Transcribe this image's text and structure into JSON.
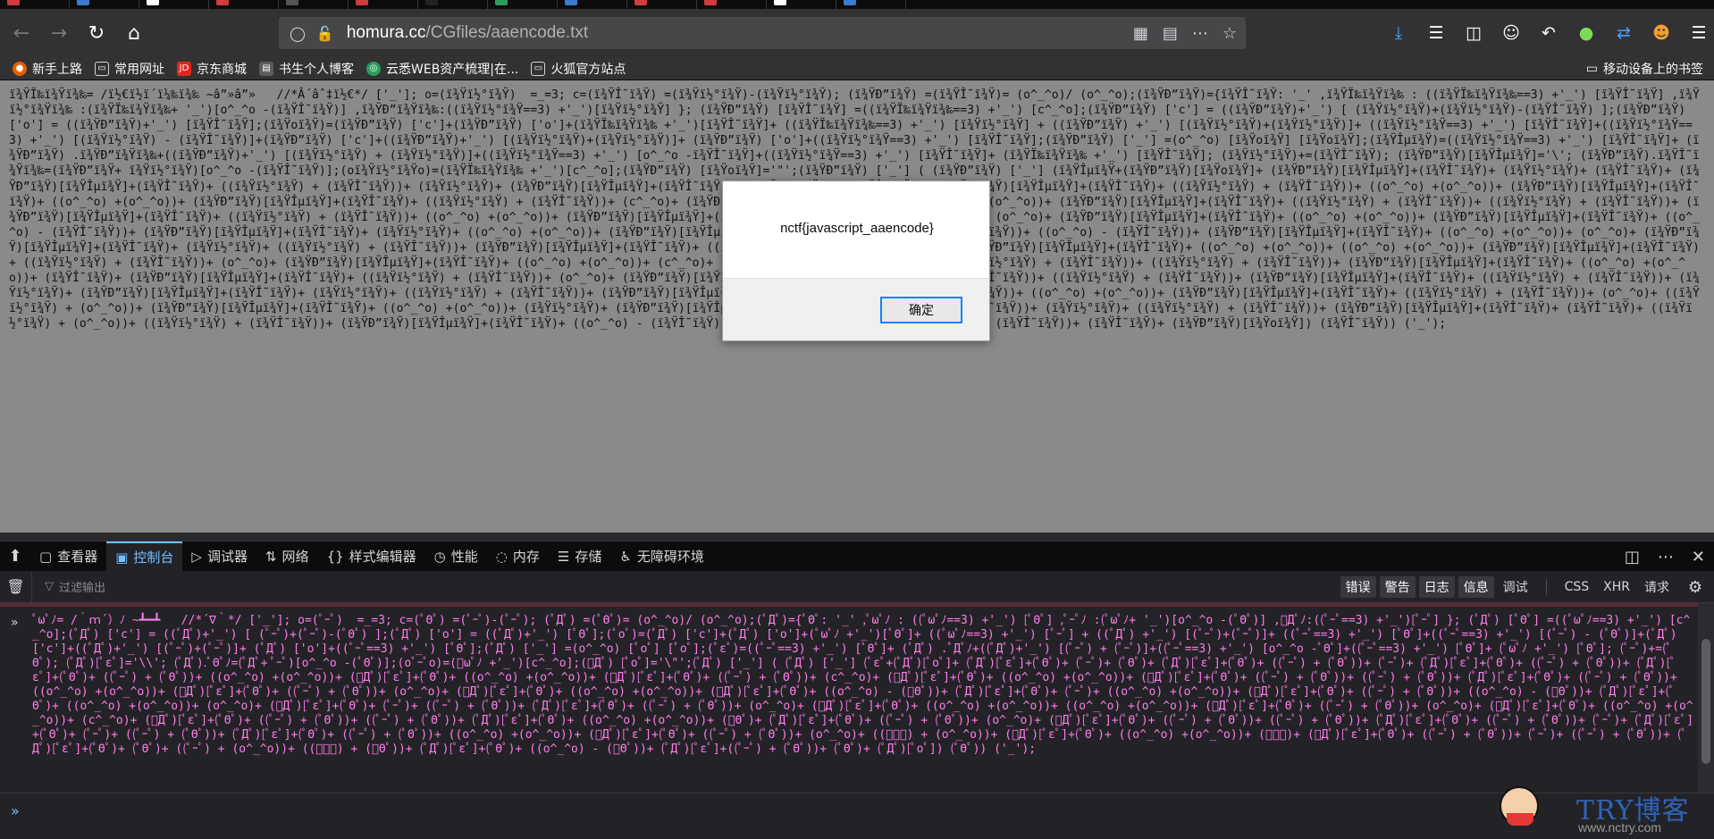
{
  "browser": {
    "url_domain": "homura.cc",
    "url_path": "/CGfiles/aaencode.txt",
    "bookmarks": [
      {
        "label": "新手上路",
        "color": "#e66000",
        "glyph": "●"
      },
      {
        "label": "常用网址",
        "color": "#6b6b6b",
        "glyph": "▭"
      },
      {
        "label": "京东商城",
        "color": "#e1251b",
        "glyph": "JD"
      },
      {
        "label": "书生个人博客",
        "color": "#5b5b5b",
        "glyph": "▤"
      },
      {
        "label": "云悉WEB资产梳理|在...",
        "color": "#2e9d5b",
        "glyph": "◎"
      },
      {
        "label": "火狐官方站点",
        "color": "#6b6b6b",
        "glyph": "▭"
      }
    ],
    "mobile_bookmarks": "移动设备上的书签"
  },
  "page": {
    "content": "ï¾ŸÏ‰ï¾Ÿï¾‰= /ï½€ï½ï´ï¼‰ï¾‰ ~â”»â”»   //*Â´âˆ‡ï½€*/ ['_']; o=(ï¾Ÿï½°ï¾Ÿ)  =_=3; c=(ï¾ŸÎ˜ï¾Ÿ) =(ï¾Ÿï½°ï¾Ÿ)-(ï¾Ÿï½°ï¾Ÿ); (ï¾ŸÐ”ï¾Ÿ) =(ï¾ŸÎ˜ï¾Ÿ)= (o^_^o)/ (o^_^o);(ï¾ŸÐ”ï¾Ÿ)={ï¾ŸÎ˜ï¾Ÿ: '_' ,ï¾ŸÏ‰ï¾Ÿï¾‰ : ((ï¾ŸÏ‰ï¾Ÿï¾‰==3) +'_') [ï¾ŸÎ˜ï¾Ÿ] ,ï¾Ÿï½°ï¾Ÿï¾‰ :(ï¾ŸÏ‰ï¾Ÿï¾‰+ '_')[o^_^o -(ï¾ŸÎ˜ï¾Ÿ)] ,ï¾ŸÐ”ï¾Ÿï¾‰:((ï¾Ÿï½°ï¾Ÿ==3) +'_')[ï¾Ÿï½°ï¾Ÿ] }; (ï¾ŸÐ”ï¾Ÿ) [ï¾ŸÎ˜ï¾Ÿ] =((ï¾ŸÏ‰ï¾Ÿï¾‰==3) +'_') [c^_^o];(ï¾ŸÐ”ï¾Ÿ) ['c'] = ((ï¾ŸÐ”ï¾Ÿ)+'_') [ (ï¾Ÿï½°ï¾Ÿ)+(ï¾Ÿï½°ï¾Ÿ)-(ï¾ŸÎ˜ï¾Ÿ) ];(ï¾ŸÐ”ï¾Ÿ) ['o'] = ((ï¾ŸÐ”ï¾Ÿ)+'_') [ï¾ŸÎ˜ï¾Ÿ];(ï¾Ÿoï¾Ÿ)=(ï¾ŸÐ”ï¾Ÿ) ['c']+(ï¾ŸÐ”ï¾Ÿ) ['o']+(ï¾ŸÏ‰ï¾Ÿï¾‰ +'_')[ï¾ŸÎ˜ï¾Ÿ]+ ((ï¾ŸÏ‰ï¾Ÿï¾‰==3) +'_') [ï¾Ÿï½°ï¾Ÿ] + ((ï¾ŸÐ”ï¾Ÿ) +'_') [(ï¾Ÿï½°ï¾Ÿ)+(ï¾Ÿï½°ï¾Ÿ)]+ ((ï¾Ÿï½°ï¾Ÿ==3) +'_') [ï¾ŸÎ˜ï¾Ÿ]+((ï¾Ÿï½°ï¾Ÿ==3) +'_') [(ï¾Ÿï½°ï¾Ÿ) - (ï¾ŸÎ˜ï¾Ÿ)]+(ï¾ŸÐ”ï¾Ÿ) ['c']+((ï¾ŸÐ”ï¾Ÿ)+'_') [(ï¾Ÿï½°ï¾Ÿ)+(ï¾Ÿï½°ï¾Ÿ)]+ (ï¾ŸÐ”ï¾Ÿ) ['o']+((ï¾Ÿï½°ï¾Ÿ==3) +'_') [ï¾ŸÎ˜ï¾Ÿ];(ï¾ŸÐ”ï¾Ÿ) ['_'] =(o^_^o) [ï¾Ÿoï¾Ÿ] [ï¾Ÿoï¾Ÿ];(ï¾ŸÎµï¾Ÿ)=((ï¾Ÿï½°ï¾Ÿ==3) +'_') [ï¾ŸÎ˜ï¾Ÿ]+ (ï¾ŸÐ”ï¾Ÿ) .ï¾ŸÐ”ï¾Ÿï¾‰+((ï¾ŸÐ”ï¾Ÿ)+'_') [(ï¾Ÿï½°ï¾Ÿ) + (ï¾Ÿï½°ï¾Ÿ)]+((ï¾Ÿï½°ï¾Ÿ==3) +'_') [o^_^o -ï¾ŸÎ˜ï¾Ÿ]+((ï¾Ÿï½°ï¾Ÿ==3) +'_') [ï¾ŸÎ˜ï¾Ÿ]+ (ï¾ŸÏ‰ï¾Ÿï¾‰ +'_') [ï¾ŸÎ˜ï¾Ÿ]; (ï¾Ÿï½°ï¾Ÿ)+=(ï¾ŸÎ˜ï¾Ÿ); (ï¾ŸÐ”ï¾Ÿ)[ï¾ŸÎµï¾Ÿ]='\\'; (ï¾ŸÐ”ï¾Ÿ).ï¾ŸÎ˜ï¾Ÿï¾‰=(ï¾ŸÐ”ï¾Ÿ+ ï¾Ÿï½°ï¾Ÿ)[o^_^o -(ï¾ŸÎ˜ï¾Ÿ)];(oï¾Ÿï½°ï¾Ÿo)=(ï¾ŸÏ‰ï¾Ÿï¾‰ +'_')[c^_^o];(ï¾ŸÐ”ï¾Ÿ) [ï¾Ÿoï¾Ÿ]='\"';(ï¾ŸÐ”ï¾Ÿ) ['_'] ( (ï¾ŸÐ”ï¾Ÿ) ['_'] (ï¾ŸÎµï¾Ÿ+(ï¾ŸÐ”ï¾Ÿ)[ï¾Ÿoï¾Ÿ]+ (ï¾ŸÐ”ï¾Ÿ)[ï¾ŸÎµï¾Ÿ]+(ï¾ŸÎ˜ï¾Ÿ)+ (ï¾Ÿï½°ï¾Ÿ)+ (ï¾ŸÎ˜ï¾Ÿ)+ (ï¾ŸÐ”ï¾Ÿ)[ï¾ŸÎµï¾Ÿ]+(ï¾ŸÎ˜ï¾Ÿ)+ ((ï¾Ÿï½°ï¾Ÿ) + (ï¾ŸÎ˜ï¾Ÿ))+ (ï¾Ÿï½°ï¾Ÿ)+ (ï¾ŸÐ”ï¾Ÿ)[ï¾ŸÎµï¾Ÿ]+(ï¾ŸÎ˜ï¾Ÿ)+ ((ï¾Ÿï½°ï¾Ÿ) + (ï¾ŸÎ˜ï¾Ÿ))+ (ï¾ŸÐ”ï¾Ÿ)[ï¾ŸÎµï¾Ÿ]+(ï¾ŸÎ˜ï¾Ÿ)+ ((ï¾Ÿï½°ï¾Ÿ) + (ï¾ŸÎ˜ï¾Ÿ))+ ((o^_^o) +(o^_^o))+ (ï¾ŸÐ”ï¾Ÿ)[ï¾ŸÎµï¾Ÿ]+(ï¾ŸÎ˜ï¾Ÿ)+ ((o^_^o) +(o^_^o))+ (ï¾ŸÐ”ï¾Ÿ)[ï¾ŸÎµï¾Ÿ]+(ï¾ŸÎ˜ï¾Ÿ)+ ((ï¾Ÿï½°ï¾Ÿ) + (ï¾ŸÎ˜ï¾Ÿ))+ (c^_^o)+ (ï¾ŸÐ”ï¾Ÿ)[ï¾ŸÎµï¾Ÿ]+(ï¾ŸÎ˜ï¾Ÿ)+ ((o^_^o) +(o^_^o))+ (ï¾ŸÐ”ï¾Ÿ)[ï¾ŸÎµï¾Ÿ]+(ï¾ŸÎ˜ï¾Ÿ)+ ((ï¾Ÿï½°ï¾Ÿ) + (ï¾ŸÎ˜ï¾Ÿ))+ ((ï¾Ÿï½°ï¾Ÿ) + (ï¾ŸÎ˜ï¾Ÿ))+ (ï¾ŸÐ”ï¾Ÿ)[ï¾ŸÎµï¾Ÿ]+(ï¾ŸÎ˜ï¾Ÿ)+ ((ï¾Ÿï½°ï¾Ÿ) + (ï¾ŸÎ˜ï¾Ÿ))+ ((o^_^o) +(o^_^o))+ (ï¾ŸÐ”ï¾Ÿ)[ï¾ŸÎµï¾Ÿ]+(ï¾ŸÎ˜ï¾Ÿ)+ ((ï¾Ÿï½°ï¾Ÿ) + (ï¾ŸÎ˜ï¾Ÿ))+ (o^_^o)+ (ï¾ŸÐ”ï¾Ÿ)[ï¾ŸÎµï¾Ÿ]+(ï¾ŸÎ˜ï¾Ÿ)+ ((o^_^o) +(o^_^o))+ (ï¾ŸÐ”ï¾Ÿ)[ï¾ŸÎµï¾Ÿ]+(ï¾ŸÎ˜ï¾Ÿ)+ ((o^_^o) - (ï¾ŸÎ˜ï¾Ÿ))+ (ï¾ŸÐ”ï¾Ÿ)[ï¾ŸÎµï¾Ÿ]+(ï¾ŸÎ˜ï¾Ÿ)+ (ï¾Ÿï½°ï¾Ÿ)+ ((o^_^o) +(o^_^o))+ (ï¾ŸÐ”ï¾Ÿ)[ï¾ŸÎµï¾Ÿ]+(ï¾ŸÎ˜ï¾Ÿ)+ ((ï¾Ÿï½°ï¾Ÿ) + (ï¾ŸÎ˜ï¾Ÿ))+ ((o^_^o) - (ï¾ŸÎ˜ï¾Ÿ))+ (ï¾ŸÐ”ï¾Ÿ)[ï¾ŸÎµï¾Ÿ]+(ï¾ŸÎ˜ï¾Ÿ)+ ((o^_^o) +(o^_^o))+ (o^_^o)+ (ï¾ŸÐ”ï¾Ÿ)[ï¾ŸÎµï¾Ÿ]+(ï¾ŸÎ˜ï¾Ÿ)+ (ï¾Ÿï½°ï¾Ÿ)+ ((ï¾Ÿï½°ï¾Ÿ) + (ï¾ŸÎ˜ï¾Ÿ))+ (ï¾ŸÐ”ï¾Ÿ)[ï¾ŸÎµï¾Ÿ]+(ï¾ŸÎ˜ï¾Ÿ)+ ((ï¾Ÿï½°ï¾Ÿ) + (ï¾ŸÎ˜ï¾Ÿ))+ (o^_^o)+ (ï¾ŸÐ”ï¾Ÿ)[ï¾ŸÎµï¾Ÿ]+(ï¾ŸÎ˜ï¾Ÿ)+ ((o^_^o) +(o^_^o))+ ((o^_^o) +(o^_^o))+ (ï¾ŸÐ”ï¾Ÿ)[ï¾ŸÎµï¾Ÿ]+(ï¾ŸÎ˜ï¾Ÿ)+ ((ï¾Ÿï½°ï¾Ÿ) + (ï¾ŸÎ˜ï¾Ÿ))+ (o^_^o)+ (ï¾ŸÐ”ï¾Ÿ)[ï¾ŸÎµï¾Ÿ]+(ï¾ŸÎ˜ï¾Ÿ)+ ((o^_^o) +(o^_^o))+ (c^_^o)+ (ï¾ŸÐ”ï¾Ÿ)[ï¾ŸÎµï¾Ÿ]+(ï¾ŸÎ˜ï¾Ÿ)+ ((ï¾Ÿï½°ï¾Ÿ) + (ï¾ŸÎ˜ï¾Ÿ))+ ((ï¾Ÿï½°ï¾Ÿ) + (ï¾ŸÎ˜ï¾Ÿ))+ (ï¾ŸÐ”ï¾Ÿ)[ï¾ŸÎµï¾Ÿ]+(ï¾ŸÎ˜ï¾Ÿ)+ ((o^_^o) +(o^_^o))+ (ï¾ŸÎ˜ï¾Ÿ)+ (ï¾ŸÐ”ï¾Ÿ)[ï¾ŸÎµï¾Ÿ]+(ï¾ŸÎ˜ï¾Ÿ)+ ((ï¾Ÿï½°ï¾Ÿ) + (ï¾ŸÎ˜ï¾Ÿ))+ (o^_^o)+ (ï¾ŸÐ”ï¾Ÿ)[ï¾ŸÎµï¾Ÿ]+(ï¾ŸÎ˜ï¾Ÿ)+ ((ï¾Ÿï½°ï¾Ÿ) + (ï¾ŸÎ˜ï¾Ÿ))+ ((ï¾Ÿï½°ï¾Ÿ) + (ï¾ŸÎ˜ï¾Ÿ))+ (ï¾ŸÐ”ï¾Ÿ)[ï¾ŸÎµï¾Ÿ]+(ï¾ŸÎ˜ï¾Ÿ)+ ((ï¾Ÿï½°ï¾Ÿ) + (ï¾ŸÎ˜ï¾Ÿ))+ (ï¾Ÿï½°ï¾Ÿ)+ (ï¾ŸÐ”ï¾Ÿ)[ï¾ŸÎµï¾Ÿ]+(ï¾ŸÎ˜ï¾Ÿ)+ (ï¾Ÿï½°ï¾Ÿ)+ ((ï¾Ÿï½°ï¾Ÿ) + (ï¾ŸÎ˜ï¾Ÿ))+ (ï¾ŸÐ”ï¾Ÿ)[ï¾ŸÎµï¾Ÿ]+(ï¾ŸÎ˜ï¾Ÿ)+ ((ï¾Ÿï½°ï¾Ÿ) + (ï¾ŸÎ˜ï¾Ÿ))+ ((o^_^o) +(o^_^o))+ (ï¾ŸÐ”ï¾Ÿ)[ï¾ŸÎµï¾Ÿ]+(ï¾ŸÎ˜ï¾Ÿ)+ ((ï¾Ÿï½°ï¾Ÿ) + (ï¾ŸÎ˜ï¾Ÿ))+ (o^_^o)+ ((ï¾Ÿï½°ï¾Ÿ) + (o^_^o))+ (ï¾ŸÐ”ï¾Ÿ)[ï¾ŸÎµï¾Ÿ]+(ï¾ŸÎ˜ï¾Ÿ)+ ((o^_^o) +(o^_^o))+ (ï¾Ÿï½°ï¾Ÿ)+ (ï¾ŸÐ”ï¾Ÿ)[ï¾ŸÎµï¾Ÿ]+(ï¾ŸÎ˜ï¾Ÿ)+ ((ï¾Ÿï½°ï¾Ÿ) + (ï¾ŸÎ˜ï¾Ÿ))+ (ï¾Ÿï½°ï¾Ÿ)+ ((ï¾Ÿï½°ï¾Ÿ) + (ï¾ŸÎ˜ï¾Ÿ))+ (ï¾ŸÐ”ï¾Ÿ)[ï¾ŸÎµï¾Ÿ]+(ï¾ŸÎ˜ï¾Ÿ)+ (ï¾ŸÎ˜ï¾Ÿ)+ ((ï¾Ÿï½°ï¾Ÿ) + (o^_^o))+ ((ï¾Ÿï½°ï¾Ÿ) + (ï¾ŸÎ˜ï¾Ÿ))+ (ï¾ŸÐ”ï¾Ÿ)[ï¾ŸÎµï¾Ÿ]+(ï¾ŸÎ˜ï¾Ÿ)+ ((o^_^o) - (ï¾ŸÎ˜ï¾Ÿ))+ (ï¾ŸÐ”ï¾Ÿ)[ï¾ŸÎµï¾Ÿ]+((ï¾Ÿï½°ï¾Ÿ) + (ï¾ŸÎ˜ï¾Ÿ))+ (ï¾ŸÎ˜ï¾Ÿ)+ (ï¾ŸÐ”ï¾Ÿ)[ï¾Ÿoï¾Ÿ]) (ï¾ŸÎ˜ï¾Ÿ)) ('_');"
  },
  "dialog": {
    "message": "nctf{javascript_aaencode}",
    "ok_label": "确定"
  },
  "devtools": {
    "tabs": [
      {
        "label": "查看器",
        "icon": "▢"
      },
      {
        "label": "控制台",
        "icon": "▣",
        "selected": true
      },
      {
        "label": "调试器",
        "icon": "▷"
      },
      {
        "label": "网络",
        "icon": "⇅"
      },
      {
        "label": "样式编辑器",
        "icon": "{}"
      },
      {
        "label": "性能",
        "icon": "◷"
      },
      {
        "label": "内存",
        "icon": "◌"
      },
      {
        "label": "存储",
        "icon": "☰"
      },
      {
        "label": "无障碍环境",
        "icon": "♿"
      }
    ],
    "filter_placeholder": "过滤输出",
    "levels": [
      {
        "label": "错误",
        "on": true
      },
      {
        "label": "警告",
        "on": true
      },
      {
        "label": "日志",
        "on": true
      },
      {
        "label": "信息",
        "on": true
      },
      {
        "label": "调试",
        "on": false
      }
    ],
    "extra_filters": [
      "CSS",
      "XHR",
      "请求"
    ],
    "console_output": "ﾟωﾟﾉ= /｀ｍ´）ﾉ ~┻━┻   //*´∇｀*/ ['_']; o=(ﾟｰﾟ)  =_=3; c=(ﾟΘﾟ) =(ﾟｰﾟ)-(ﾟｰﾟ); (ﾟДﾟ) =(ﾟΘﾟ)= (o^_^o)/ (o^_^o);(ﾟДﾟ)={ﾟΘﾟ: '_' ,ﾟωﾟﾉ : ((ﾟωﾟﾉ==3) +'_') [ﾟΘﾟ] ,ﾟｰﾟﾉ :(ﾟωﾟﾉ+ '_')[o^_^o -(ﾟΘﾟ)] ,ﾟДﾟﾉ:((ﾟｰﾟ==3) +'_')[ﾟｰﾟ] }; (ﾟДﾟ) [ﾟΘﾟ] =((ﾟωﾟﾉ==3) +'_') [c^_^o];(ﾟДﾟ) ['c'] = ((ﾟДﾟ)+'_') [ (ﾟｰﾟ)+(ﾟｰﾟ)-(ﾟΘﾟ) ];(ﾟДﾟ) ['o'] = ((ﾟДﾟ)+'_') [ﾟΘﾟ];(ﾟoﾟ)=(ﾟДﾟ) ['c']+(ﾟДﾟ) ['o']+(ﾟωﾟﾉ +'_')[ﾟΘﾟ]+ ((ﾟωﾟﾉ==3) +'_') [ﾟｰﾟ] + ((ﾟДﾟ) +'_') [(ﾟｰﾟ)+(ﾟｰﾟ)]+ ((ﾟｰﾟ==3) +'_') [ﾟΘﾟ]+((ﾟｰﾟ==3) +'_') [(ﾟｰﾟ) - (ﾟΘﾟ)]+(ﾟДﾟ) ['c']+((ﾟДﾟ)+'_') [(ﾟｰﾟ)+(ﾟｰﾟ)]+ (ﾟДﾟ) ['o']+((ﾟｰﾟ==3) +'_') [ﾟΘﾟ];(ﾟДﾟ) ['_'] =(o^_^o) [ﾟoﾟ] [ﾟoﾟ];(ﾟεﾟ)=((ﾟｰﾟ==3) +'_') [ﾟΘﾟ]+ (ﾟДﾟ) .ﾟДﾟﾉ+((ﾟДﾟ)+'_') [(ﾟｰﾟ) + (ﾟｰﾟ)]+((ﾟｰﾟ==3) +'_') [o^_^o -ﾟΘﾟ]+((ﾟｰﾟ==3) +'_') [ﾟΘﾟ]+ (ﾟωﾟﾉ +'_') [ﾟΘﾟ]; (ﾟｰﾟ)+=(ﾟΘﾟ); (ﾟДﾟ)[ﾟεﾟ]='\\\\'; (ﾟДﾟ).ﾟΘﾟﾉ=(ﾟДﾟ+ ﾟｰﾟ)[o^_^o -(ﾟΘﾟ)];(oﾟｰﾟo)=(ﾟωﾟﾉ +'_')[c^_^o];(ﾟДﾟ) [ﾟoﾟ]='\\\"';(ﾟДﾟ) ['_'] ( (ﾟДﾟ) ['_'] (ﾟεﾟ+(ﾟДﾟ)[ﾟoﾟ]+ (ﾟДﾟ)[ﾟεﾟ]+(ﾟΘﾟ)+ (ﾟｰﾟ)+ (ﾟΘﾟ)+ (ﾟДﾟ)[ﾟεﾟ]+(ﾟΘﾟ)+ ((ﾟｰﾟ) + (ﾟΘﾟ))+ (ﾟｰﾟ)+ (ﾟДﾟ)[ﾟεﾟ]+(ﾟΘﾟ)+ ((ﾟｰﾟ) + (ﾟΘﾟ))+ (ﾟДﾟ)[ﾟεﾟ]+(ﾟΘﾟ)+ ((ﾟｰﾟ) + (ﾟΘﾟ))+ ((o^_^o) +(o^_^o))+ (ﾟДﾟ)[ﾟεﾟ]+(ﾟΘﾟ)+ ((o^_^o) +(o^_^o))+ (ﾟДﾟ)[ﾟεﾟ]+(ﾟΘﾟ)+ ((ﾟｰﾟ) + (ﾟΘﾟ))+ (c^_^o)+ (ﾟДﾟ)[ﾟεﾟ]+(ﾟΘﾟ)+ ((o^_^o) +(o^_^o))+ (ﾟДﾟ)[ﾟεﾟ]+(ﾟΘﾟ)+ ((ﾟｰﾟ) + (ﾟΘﾟ))+ ((ﾟｰﾟ) + (ﾟΘﾟ))+ (ﾟДﾟ)[ﾟεﾟ]+(ﾟΘﾟ)+ ((ﾟｰﾟ) + (ﾟΘﾟ))+ ((o^_^o) +(o^_^o))+ (ﾟДﾟ)[ﾟεﾟ]+(ﾟΘﾟ)+ ((ﾟｰﾟ) + (ﾟΘﾟ))+ (o^_^o)+ (ﾟДﾟ)[ﾟεﾟ]+(ﾟΘﾟ)+ ((o^_^o) +(o^_^o))+ (ﾟДﾟ)[ﾟεﾟ]+(ﾟΘﾟ)+ ((o^_^o) - (ﾟΘﾟ))+ (ﾟДﾟ)[ﾟεﾟ]+(ﾟΘﾟ)+ (ﾟｰﾟ)+ ((o^_^o) +(o^_^o))+ (ﾟДﾟ)[ﾟεﾟ]+(ﾟΘﾟ)+ ((ﾟｰﾟ) + (ﾟΘﾟ))+ ((o^_^o) - (ﾟΘﾟ))+ (ﾟДﾟ)[ﾟεﾟ]+(ﾟΘﾟ)+ ((o^_^o) +(o^_^o))+ (o^_^o)+ (ﾟДﾟ)[ﾟεﾟ]+(ﾟΘﾟ)+ (ﾟｰﾟ)+ ((ﾟｰﾟ) + (ﾟΘﾟ))+ (ﾟДﾟ)[ﾟεﾟ]+(ﾟΘﾟ)+ ((ﾟｰﾟ) + (ﾟΘﾟ))+ (o^_^o)+ (ﾟДﾟ)[ﾟεﾟ]+(ﾟΘﾟ)+ ((o^_^o) +(o^_^o))+ ((o^_^o) +(o^_^o))+ (ﾟДﾟ)[ﾟεﾟ]+(ﾟΘﾟ)+ ((ﾟｰﾟ) + (ﾟΘﾟ))+ (o^_^o)+ (ﾟДﾟ)[ﾟεﾟ]+(ﾟΘﾟ)+ ((o^_^o) +(o^_^o))+ (c^_^o)+ (ﾟДﾟ)[ﾟεﾟ]+(ﾟΘﾟ)+ ((ﾟｰﾟ) + (ﾟΘﾟ))+ ((ﾟｰﾟ) + (ﾟΘﾟ))+ (ﾟДﾟ)[ﾟεﾟ]+(ﾟΘﾟ)+ ((o^_^o) +(o^_^o))+ (ﾟΘﾟ)+ (ﾟДﾟ)[ﾟεﾟ]+(ﾟΘﾟ)+ ((ﾟｰﾟ) + (ﾟΘﾟ))+ (o^_^o)+ (ﾟДﾟ)[ﾟεﾟ]+(ﾟΘﾟ)+ ((ﾟｰﾟ) + (ﾟΘﾟ))+ ((ﾟｰﾟ) + (ﾟΘﾟ))+ (ﾟДﾟ)[ﾟεﾟ]+(ﾟΘﾟ)+ ((ﾟｰﾟ) + (ﾟΘﾟ))+ (ﾟｰﾟ)+ (ﾟДﾟ)[ﾟεﾟ]+(ﾟΘﾟ)+ (ﾟｰﾟ)+ ((ﾟｰﾟ) + (ﾟΘﾟ))+ (ﾟДﾟ)[ﾟεﾟ]+(ﾟΘﾟ)+ ((ﾟｰﾟ) + (ﾟΘﾟ))+ ((o^_^o) +(o^_^o))+ (ﾟДﾟ)[ﾟεﾟ]+(ﾟΘﾟ)+ ((ﾟｰﾟ) + (ﾟΘﾟ))+ (o^_^o)+ ((ﾟｰﾟ) + (o^_^o))+ (ﾟДﾟ)[ﾟεﾟ]+(ﾟΘﾟ)+ ((o^_^o) +(o^_^o))+ (ﾟｰﾟ)+ (ﾟДﾟ)[ﾟεﾟ]+(ﾟΘﾟ)+ ((ﾟｰﾟ) + (ﾟΘﾟ))+ (ﾟｰﾟ)+ ((ﾟｰﾟ) + (ﾟΘﾟ))+ (ﾟДﾟ)[ﾟεﾟ]+(ﾟΘﾟ)+ (ﾟΘﾟ)+ ((ﾟｰﾟ) + (o^_^o))+ ((ﾟｰﾟ) + (ﾟΘﾟ))+ (ﾟДﾟ)[ﾟεﾟ]+(ﾟΘﾟ)+ ((o^_^o) - (ﾟΘﾟ))+ (ﾟДﾟ)[ﾟεﾟ]+((ﾟｰﾟ) + (ﾟΘﾟ))+ (ﾟΘﾟ)+ (ﾟДﾟ)[ﾟoﾟ]) (ﾟΘﾟ)) ('_');"
  },
  "watermark": {
    "brand": "TRY博客",
    "site": "www.nctry.com"
  }
}
